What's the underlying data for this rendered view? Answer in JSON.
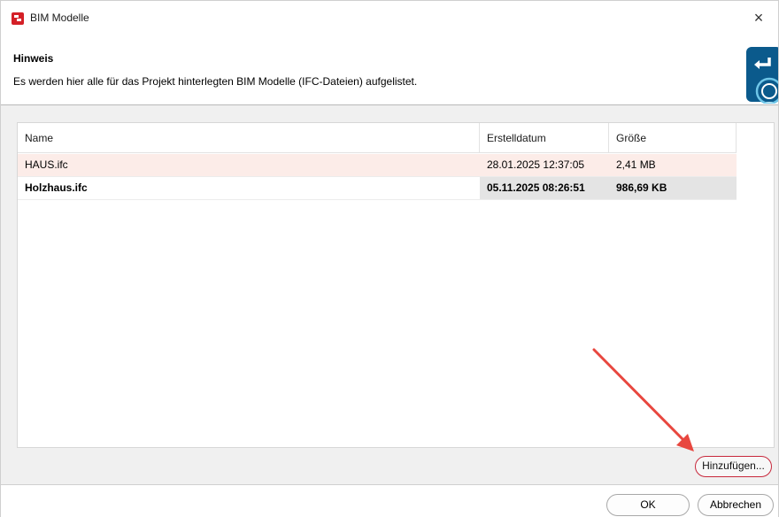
{
  "window": {
    "title": "BIM Modelle",
    "close_glyph": "×",
    "app_icon": "bim-app-icon"
  },
  "hint": {
    "title": "Hinweis",
    "text": "Es werden hier alle für das Projekt hinterlegten BIM Modelle (IFC-Dateien) aufgelistet.",
    "logo": "enter-key-logo"
  },
  "table": {
    "columns": [
      "Name",
      "Erstelldatum",
      "Größe"
    ],
    "rows": [
      {
        "name": "HAUS.ifc",
        "date": "28.01.2025 12:37:05",
        "size": "2,41 MB"
      },
      {
        "name": "Holzhaus.ifc",
        "date": "05.11.2025 08:26:51",
        "size": "986,69 KB"
      }
    ]
  },
  "buttons": {
    "add": "Hinzufügen...",
    "ok": "OK",
    "cancel": "Abbrechen"
  },
  "colors": {
    "accent_red": "#d42027",
    "highlight_ring": "#c8283c",
    "annotation_arrow": "#e8473f",
    "logo_blue": "#0b5a8c"
  }
}
